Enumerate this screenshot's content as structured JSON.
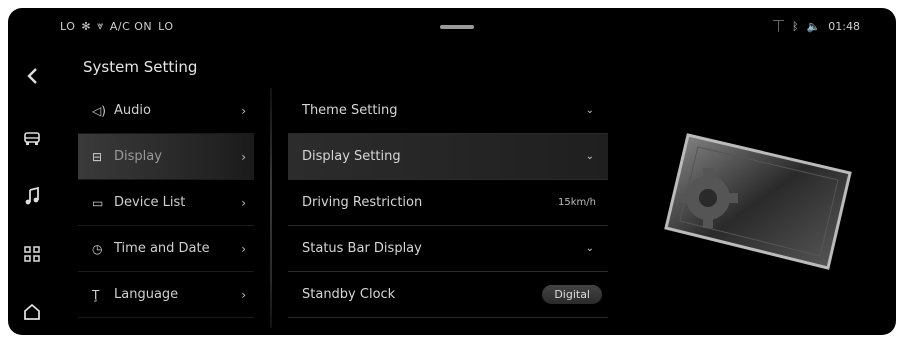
{
  "status_bar": {
    "left_items": [
      "LO",
      "A/C ON",
      "LO"
    ],
    "right_time": "01:48"
  },
  "page": {
    "title": "System Setting"
  },
  "sidebar_menu": [
    {
      "label": "Audio",
      "icon": "speaker-icon"
    },
    {
      "label": "Display",
      "icon": "display-icon"
    },
    {
      "label": "Device List",
      "icon": "device-icon"
    },
    {
      "label": "Time and Date",
      "icon": "clock-icon"
    },
    {
      "label": "Language",
      "icon": "language-icon"
    }
  ],
  "display_settings": [
    {
      "label": "Theme Setting",
      "control": "chevron-down"
    },
    {
      "label": "Display Setting",
      "control": "chevron-down"
    },
    {
      "label": "Driving Restriction",
      "control": "value",
      "value": "15km/h"
    },
    {
      "label": "Status Bar Display",
      "control": "chevron-down"
    },
    {
      "label": "Standby Clock",
      "control": "pill",
      "value": "Digital"
    }
  ],
  "rail_icons": [
    "back-icon",
    "car-icon",
    "music-icon",
    "apps-icon",
    "home-icon"
  ],
  "colors": {
    "background": "#000000",
    "text": "#cfcfcf",
    "active_row": "#2c2c2c"
  }
}
